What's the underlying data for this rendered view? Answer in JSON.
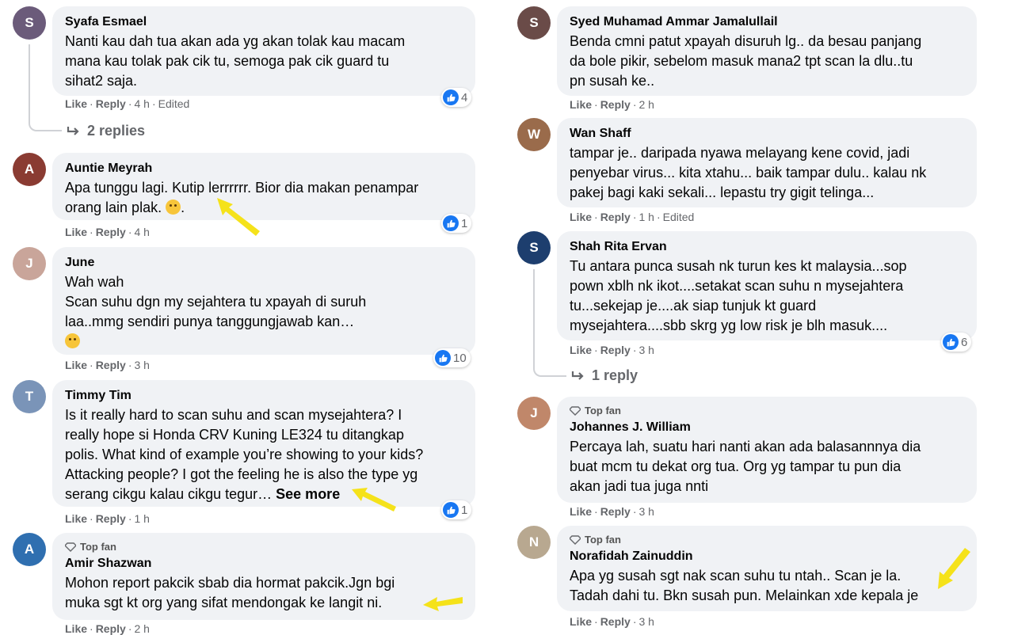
{
  "ui": {
    "like": "Like",
    "reply": "Reply",
    "top_fan": "Top fan",
    "edited": "Edited",
    "see_more": "See more"
  },
  "left": [
    {
      "author": "Syafa Esmael",
      "text": "Nanti kau dah tua akan ada yg akan tolak kau macam\nmana kau tolak pak cik tu, semoga pak cik guard tu\nsihat2 saja.",
      "time": "4 h",
      "likes": "4",
      "replies": "2 replies",
      "avatar_color": "#6b5b7a"
    },
    {
      "author": "Auntie Meyrah",
      "text": "Apa tunggu lagi. Kutip lerrrrrr. Bior dia makan penampar\norang lain plak.",
      "time": "4 h",
      "likes": "1",
      "avatar_color": "#8a3b32"
    },
    {
      "author": "June",
      "text": "Wah wah\nScan suhu dgn my sejahtera tu xpayah di suruh\nlaa..mmg sendiri punya tanggungjawab kan…",
      "time": "3 h",
      "likes": "10",
      "avatar_color": "#c9a59a"
    },
    {
      "author": "Timmy Tim",
      "text": "Is it really hard to scan suhu and scan mysejahtera? I\nreally hope si Honda CRV Kuning LE324 tu ditangkap\npolis. What kind of example you’re showing to your kids?\nAttacking people? I got the feeling he is also the type yg\nserang cikgu kalau cikgu tegur… ",
      "time": "1 h",
      "likes": "1",
      "avatar_color": "#7a94b8"
    },
    {
      "author": "Amir Shazwan",
      "text": "Mohon report pakcik sbab dia hormat pakcik.Jgn bgi\nmuka sgt kt org yang sifat mendongak ke langit ni.",
      "time": "2 h",
      "avatar_color": "#2f6fb0"
    }
  ],
  "right": [
    {
      "author": "Syed Muhamad Ammar Jamalullail",
      "text": "Benda cmni patut xpayah disuruh lg.. da besau panjang\nda bole pikir, sebelom masuk mana2 tpt scan la dlu..tu\npn susah ke..",
      "time": "2 h",
      "avatar_color": "#6a4b48"
    },
    {
      "author": "Wan Shaff",
      "text": "tampar je.. daripada nyawa melayang kene covid, jadi\npenyebar virus... kita xtahu... baik tampar dulu.. kalau nk\npakej bagi kaki sekali... lepastu try gigit telinga...",
      "time": "1 h",
      "avatar_color": "#9a6b4b"
    },
    {
      "author": "Shah Rita Ervan",
      "text": "Tu antara punca susah nk turun kes kt malaysia...sop\npown xblh nk ikot....setakat scan suhu n mysejahtera\ntu...sekejap je....ak siap tunjuk kt guard\nmysejahtera....sbb skrg yg low risk je blh masuk....",
      "time": "3 h",
      "likes": "6",
      "replies": "1 reply",
      "avatar_color": "#1d3e6e"
    },
    {
      "author": "Johannes J. William",
      "text": "Percaya lah, suatu hari nanti akan ada balasannnya dia\nbuat mcm tu dekat org tua. Org yg tampar tu pun dia\nakan jadi tua juga nnti",
      "time": "3 h",
      "avatar_color": "#c0876a"
    },
    {
      "author": "Norafidah Zainuddin",
      "text": "Apa yg susah sgt nak scan suhu tu ntah.. Scan je la.\nTadah dahi tu. Bkn susah pun. Melainkan xde kepala je",
      "time": "3 h",
      "avatar_color": "#b8a890"
    }
  ],
  "colors": {
    "bubble": "#f0f2f5",
    "like_blue": "#1877f2",
    "meta_gray": "#65676b",
    "arrow": "#f5e21a"
  }
}
